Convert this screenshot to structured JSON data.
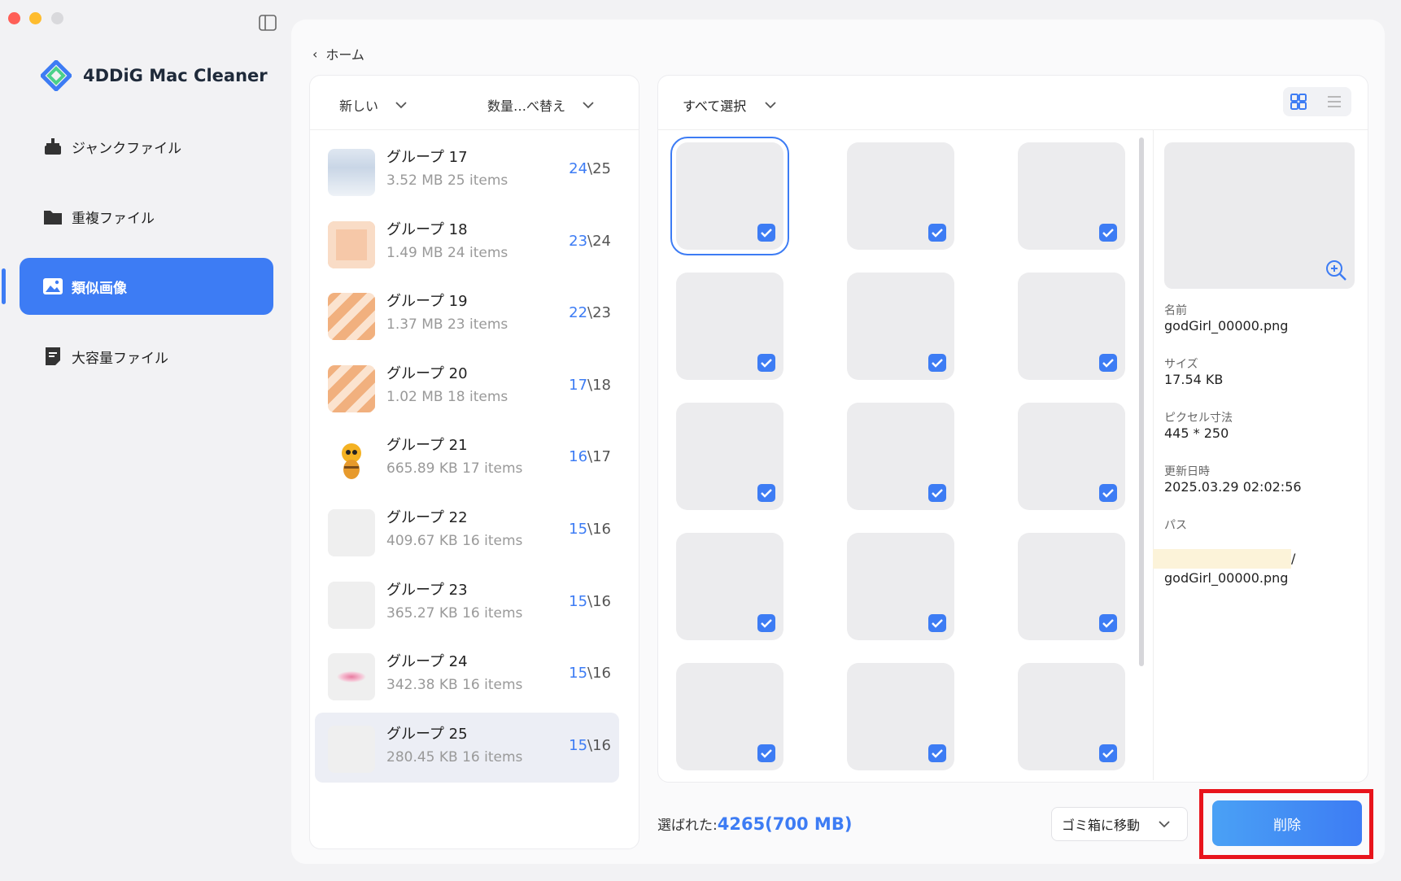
{
  "app": {
    "name": "4DDiG Mac Cleaner"
  },
  "window_controls": [
    "close",
    "minimize",
    "zoom"
  ],
  "nav": {
    "items": [
      {
        "label": "ジャンクファイル",
        "icon": "broom-icon",
        "active": false
      },
      {
        "label": "重複ファイル",
        "icon": "folder-icon",
        "active": false
      },
      {
        "label": "類似画像",
        "icon": "image-icon",
        "active": true
      },
      {
        "label": "大容量ファイル",
        "icon": "file-icon",
        "active": false
      }
    ]
  },
  "breadcrumb": {
    "back_label": "ホーム"
  },
  "groups_panel": {
    "sort_label": "新しい",
    "sort2_label": "数量…べ替え",
    "groups": [
      {
        "name": "グループ 17",
        "meta": "3.52  MB  25 items",
        "selected": "24",
        "total": "25",
        "thumb": "sky"
      },
      {
        "name": "グループ 18",
        "meta": "1.49  MB  24 items",
        "selected": "23",
        "total": "24",
        "thumb": "orange"
      },
      {
        "name": "グループ 19",
        "meta": "1.37  MB  23 items",
        "selected": "22",
        "total": "23",
        "thumb": "stripes"
      },
      {
        "name": "グループ 20",
        "meta": "1.02  MB  18 items",
        "selected": "17",
        "total": "18",
        "thumb": "stripes"
      },
      {
        "name": "グループ 21",
        "meta": "665.89  KB  17 items",
        "selected": "16",
        "total": "17",
        "thumb": "bee"
      },
      {
        "name": "グループ 22",
        "meta": "409.67  KB  16 items",
        "selected": "15",
        "total": "16",
        "thumb": "dots"
      },
      {
        "name": "グループ 23",
        "meta": "365.27  KB  16 items",
        "selected": "15",
        "total": "16",
        "thumb": "dots"
      },
      {
        "name": "グループ 24",
        "meta": "342.38  KB  16 items",
        "selected": "15",
        "total": "16",
        "thumb": "pink"
      },
      {
        "name": "グループ 25",
        "meta": "280.45  KB  16 items",
        "selected": "15",
        "total": "16",
        "thumb": "dots"
      }
    ]
  },
  "grid_panel": {
    "select_all_label": "すべて選択",
    "view_mode": "grid",
    "tiles_rows": 5,
    "tiles_cols": 3,
    "all_checked": true
  },
  "details": {
    "name_label": "名前",
    "name_value": "godGirl_00000.png",
    "size_label": "サイズ",
    "size_value": "17.54  KB",
    "dims_label": "ピクセル寸法",
    "dims_value": "445 * 250",
    "date_label": "更新日時",
    "date_value": "2025.03.29 02:02:56",
    "path_label": "パス",
    "path_value_end": "/",
    "path_value_file": "godGirl_00000.png"
  },
  "footer": {
    "selected_label": "選ばれた:",
    "selected_value": "4265(700  MB)",
    "mode_label": "ゴミ箱に移動",
    "delete_label": "削除"
  },
  "colors": {
    "accent": "#3d7cf4",
    "highlight_box": "#e8141c"
  }
}
